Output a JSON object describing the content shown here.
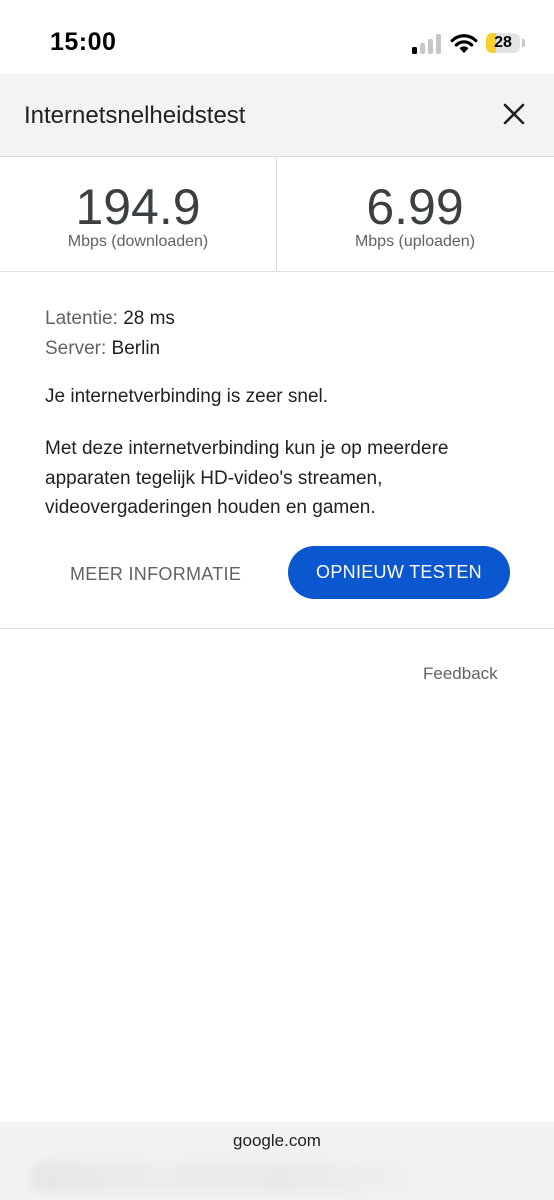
{
  "status_bar": {
    "time": "15:00",
    "battery_level": "28",
    "battery_fraction": 0.28,
    "battery_color": "#f7d02c",
    "signal_icon": "cellular-signal-icon",
    "wifi_icon": "wifi-icon"
  },
  "header": {
    "title": "Internetsnelheidstest",
    "close_icon": "close-icon"
  },
  "results": {
    "download": {
      "value": "194.9",
      "unit": "Mbps (downloaden)"
    },
    "upload": {
      "value": "6.99",
      "unit": "Mbps (uploaden)"
    }
  },
  "info": {
    "latency_label": "Latentie:",
    "latency_value": "28 ms",
    "server_label": "Server:",
    "server_value": "Berlin",
    "summary": "Je internetverbinding is zeer snel.",
    "description": "Met deze internetverbinding kun je op meerdere apparaten tegelijk HD-video's streamen, videovergaderingen houden en gamen.",
    "more_info_label": "MEER INFORMATIE",
    "retest_label": "OPNIEUW TESTEN"
  },
  "accent_color": "#0b57d0",
  "feedback_label": "Feedback",
  "bottom_bar": {
    "url": "google.com"
  }
}
